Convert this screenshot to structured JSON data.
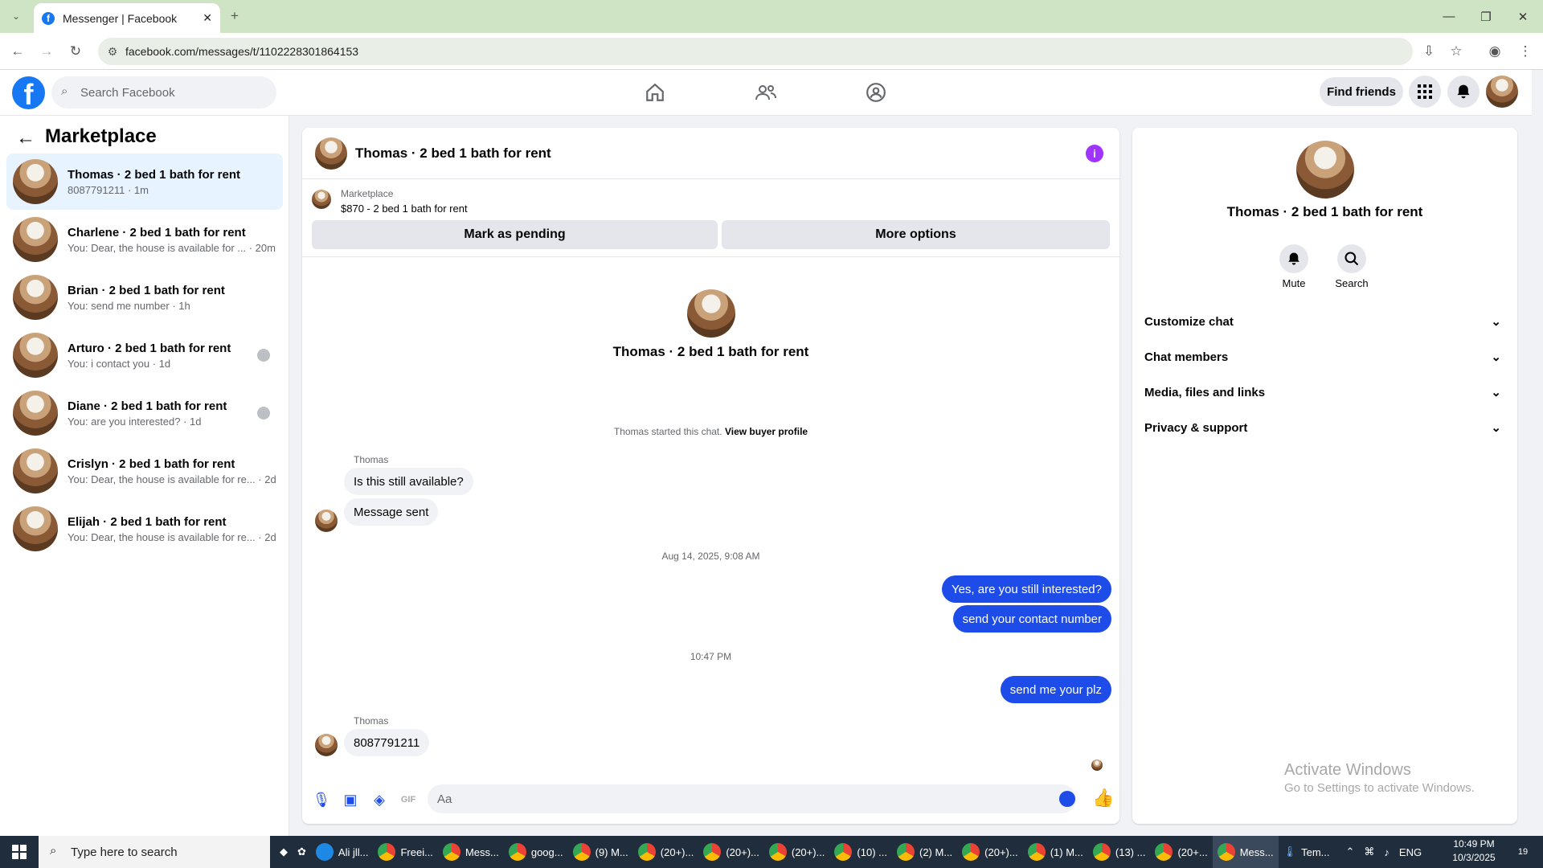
{
  "browser": {
    "tab_title": "Messenger | Facebook",
    "url": "facebook.com/messages/t/1102228301864153",
    "fav_letter": "f"
  },
  "header": {
    "search_placeholder": "Search Facebook",
    "find_friends": "Find friends",
    "logo_letter": "f"
  },
  "sidebar": {
    "title": "Marketplace",
    "items": [
      {
        "name": "Thomas · 2 bed 1 bath for rent",
        "preview": "8087791211 · 1m"
      },
      {
        "name": "Charlene · 2 bed 1 bath for rent",
        "preview": "You: Dear, the house is available for ... · 20m"
      },
      {
        "name": "Brian · 2 bed 1 bath for rent",
        "preview": "You: send me number · 1h"
      },
      {
        "name": "Arturo · 2 bed 1 bath for rent",
        "preview": "You: i contact you · 1d"
      },
      {
        "name": "Diane · 2 bed 1 bath for rent",
        "preview": "You: are you interested? · 1d"
      },
      {
        "name": "Crislyn · 2 bed 1 bath for rent",
        "preview": "You: Dear, the house is available for re... · 2d"
      },
      {
        "name": "Elijah · 2 bed 1 bath for rent",
        "preview": "You: Dear, the house is available for re... · 2d"
      }
    ]
  },
  "chat": {
    "title": "Thomas · 2 bed 1 bath for rent",
    "marketplace_label": "Marketplace",
    "listing": "$870 - 2 bed 1 bath for rent",
    "mark_pending": "Mark as pending",
    "more_options": "More options",
    "started": "Thomas started this chat.",
    "view_profile": "View buyer profile",
    "sender": "Thomas",
    "msg1": "Is this still available?",
    "msg2": "Message sent",
    "stamp1": "Aug 14, 2025, 9:08 AM",
    "out1": "Yes, are you still interested?",
    "out2": "send your contact number",
    "stamp2": "10:47 PM",
    "out3": "send me your plz",
    "msg3": "8087791211",
    "composer_placeholder": "Aa"
  },
  "info": {
    "name": "Thomas · 2 bed 1 bath for rent",
    "mute": "Mute",
    "search": "Search",
    "sections": [
      "Customize chat",
      "Chat members",
      "Media, files and links",
      "Privacy & support"
    ]
  },
  "watermark": {
    "title": "Activate Windows",
    "subtitle": "Go to Settings to activate Windows."
  },
  "taskbar": {
    "search_placeholder": "Type here to search",
    "apps": [
      "Ali jll...",
      "Freei...",
      "Mess...",
      "goog...",
      "(9) M...",
      "(20+)...",
      "(20+)...",
      "(20+)...",
      "(10) ...",
      "(2) M...",
      "(20+)...",
      "(1) M...",
      "(13) ...",
      "(20+...",
      "Mess...",
      "Tem..."
    ],
    "lang": "ENG",
    "time": "10:49 PM",
    "date": "10/3/2025",
    "notif": "19"
  },
  "colors": {
    "brand": "#1877f2",
    "outgoing": "#1e4ce8",
    "info": "#a033ff"
  }
}
